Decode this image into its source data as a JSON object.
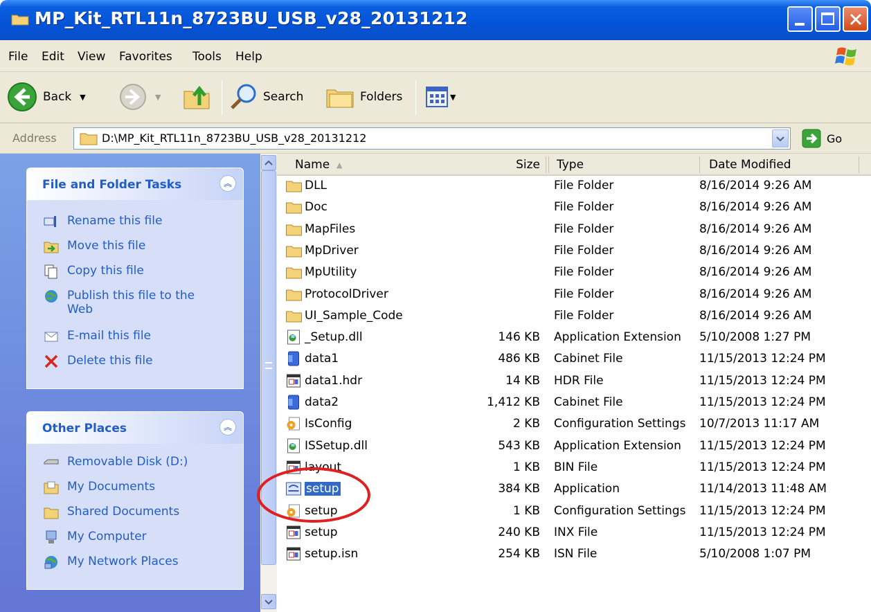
{
  "window": {
    "title": "MP_Kit_RTL11n_8723BU_USB_v28_20131212",
    "colors": {
      "titlebar": "#0453d8",
      "taskpane": "#6f8ddf",
      "link": "#215dc6",
      "selection": "#316ac5",
      "callout": "#e02020"
    }
  },
  "menu": [
    "File",
    "Edit",
    "View",
    "Favorites",
    "Tools",
    "Help"
  ],
  "toolbar": {
    "back": "Back",
    "search": "Search",
    "folders": "Folders"
  },
  "address": {
    "label": "Address",
    "path": "D:\\MP_Kit_RTL11n_8723BU_USB_v28_20131212",
    "go": "Go"
  },
  "tasks": {
    "title": "File and Folder Tasks",
    "items": [
      {
        "label": "Rename this file",
        "icon": "rename-icon"
      },
      {
        "label": "Move this file",
        "icon": "move-icon"
      },
      {
        "label": "Copy this file",
        "icon": "copy-icon"
      },
      {
        "label": "Publish this file to the Web",
        "icon": "publish-icon"
      },
      {
        "label": "E-mail this file",
        "icon": "email-icon"
      },
      {
        "label": "Delete this file",
        "icon": "delete-icon"
      }
    ]
  },
  "places": {
    "title": "Other Places",
    "items": [
      {
        "label": "Removable Disk (D:)",
        "icon": "removable-disk-icon"
      },
      {
        "label": "My Documents",
        "icon": "my-documents-icon"
      },
      {
        "label": "Shared Documents",
        "icon": "shared-documents-icon"
      },
      {
        "label": "My Computer",
        "icon": "my-computer-icon"
      },
      {
        "label": "My Network Places",
        "icon": "network-places-icon"
      }
    ]
  },
  "columns": {
    "name": "Name",
    "size": "Size",
    "type": "Type",
    "date": "Date Modified"
  },
  "files": [
    {
      "name": "DLL",
      "size": "",
      "type": "File Folder",
      "date": "8/16/2014 9:26 AM",
      "icon": "folder-icon"
    },
    {
      "name": "Doc",
      "size": "",
      "type": "File Folder",
      "date": "8/16/2014 9:26 AM",
      "icon": "folder-icon"
    },
    {
      "name": "MapFiles",
      "size": "",
      "type": "File Folder",
      "date": "8/16/2014 9:26 AM",
      "icon": "folder-icon"
    },
    {
      "name": "MpDriver",
      "size": "",
      "type": "File Folder",
      "date": "8/16/2014 9:26 AM",
      "icon": "folder-icon"
    },
    {
      "name": "MpUtility",
      "size": "",
      "type": "File Folder",
      "date": "8/16/2014 9:26 AM",
      "icon": "folder-icon"
    },
    {
      "name": "ProtocolDriver",
      "size": "",
      "type": "File Folder",
      "date": "8/16/2014 9:26 AM",
      "icon": "folder-icon"
    },
    {
      "name": "UI_Sample_Code",
      "size": "",
      "type": "File Folder",
      "date": "8/16/2014 9:26 AM",
      "icon": "folder-icon"
    },
    {
      "name": "_Setup.dll",
      "size": "146 KB",
      "type": "Application Extension",
      "date": "5/10/2008 1:27 PM",
      "icon": "dll-icon"
    },
    {
      "name": "data1",
      "size": "486 KB",
      "type": "Cabinet File",
      "date": "11/15/2013 12:24 PM",
      "icon": "cabinet-icon"
    },
    {
      "name": "data1.hdr",
      "size": "14 KB",
      "type": "HDR File",
      "date": "11/15/2013 12:24 PM",
      "icon": "generic-file-icon"
    },
    {
      "name": "data2",
      "size": "1,412 KB",
      "type": "Cabinet File",
      "date": "11/15/2013 12:24 PM",
      "icon": "cabinet-icon"
    },
    {
      "name": "IsConfig",
      "size": "2 KB",
      "type": "Configuration Settings",
      "date": "10/7/2013 11:17 AM",
      "icon": "config-icon"
    },
    {
      "name": "ISSetup.dll",
      "size": "543 KB",
      "type": "Application Extension",
      "date": "11/15/2013 12:24 PM",
      "icon": "dll-icon"
    },
    {
      "name": "layout",
      "size": "1 KB",
      "type": "BIN File",
      "date": "11/15/2013 12:24 PM",
      "icon": "generic-file-icon"
    },
    {
      "name": "setup",
      "size": "384 KB",
      "type": "Application",
      "date": "11/14/2013 11:48 AM",
      "icon": "application-icon",
      "selected": true
    },
    {
      "name": "setup",
      "size": "1 KB",
      "type": "Configuration Settings",
      "date": "11/15/2013 12:24 PM",
      "icon": "config-icon"
    },
    {
      "name": "setup",
      "size": "240 KB",
      "type": "INX File",
      "date": "11/15/2013 12:24 PM",
      "icon": "generic-file-icon"
    },
    {
      "name": "setup.isn",
      "size": "254 KB",
      "type": "ISN File",
      "date": "5/10/2008 1:07 PM",
      "icon": "generic-file-icon"
    }
  ]
}
